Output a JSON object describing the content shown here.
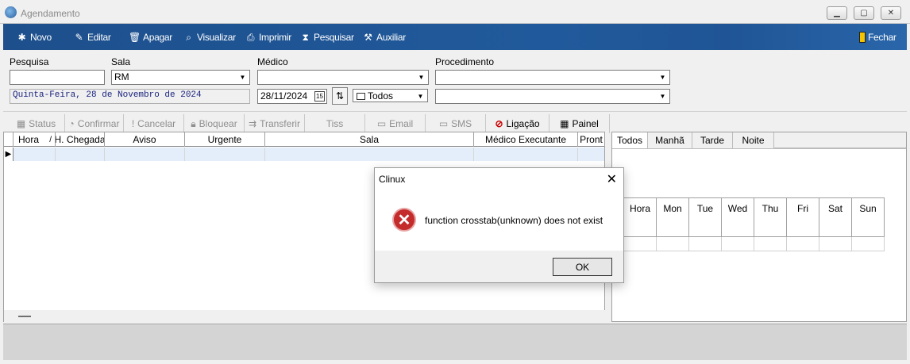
{
  "window": {
    "title": "Agendamento",
    "close_label": "Fechar"
  },
  "toolbar": {
    "novo": "Novo",
    "editar": "Editar",
    "apagar": "Apagar",
    "visualizar": "Visualizar",
    "imprimir": "Imprimir",
    "pesquisar": "Pesquisar",
    "auxiliar": "Auxiliar"
  },
  "form": {
    "pesquisa_label": "Pesquisa",
    "pesquisa_value": "",
    "sala_label": "Sala",
    "sala_value": "RM",
    "medico_label": "Médico",
    "medico_value": "",
    "procedimento_label": "Procedimento",
    "procedimento_value": "",
    "date_text": "Quinta-Feira, 28 de Novembro de 2024",
    "date_value": "28/11/2024",
    "period_value": "Todos",
    "procedimento2_value": ""
  },
  "actions": {
    "status": "Status",
    "confirmar": "Confirmar",
    "cancelar": "Cancelar",
    "bloquear": "Bloquear",
    "transferir": "Transferir",
    "tiss": "Tiss",
    "email": "Email",
    "sms": "SMS",
    "ligacao": "Ligação",
    "painel": "Painel"
  },
  "grid": {
    "columns": [
      "Hora",
      "H. Chegada",
      "Aviso",
      "Urgente",
      "Sala",
      "Médico Executante",
      "Pront"
    ],
    "sort_indicator": "/"
  },
  "tabs": [
    "Todos",
    "Manhã",
    "Tarde",
    "Noite"
  ],
  "calendar": {
    "columns": [
      "Hora",
      "Mon",
      "Tue",
      "Wed",
      "Thu",
      "Fri",
      "Sat",
      "Sun"
    ]
  },
  "dialog": {
    "title": "Clinux",
    "message": "function crosstab(unknown) does not exist",
    "ok": "OK"
  },
  "colors": {
    "toolbar": "#1d4f8c",
    "row_highlight": "#e4eefa",
    "error": "#c42b2b"
  }
}
